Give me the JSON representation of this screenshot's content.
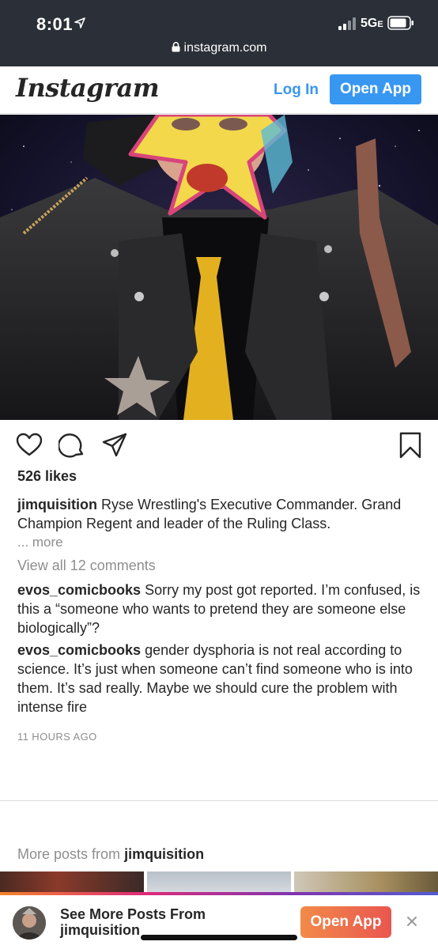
{
  "status_bar": {
    "time": "8:01",
    "network": "5G",
    "network_suffix": "E",
    "url": "instagram.com",
    "icons": [
      "location-arrow-icon",
      "signal-icon",
      "battery-icon",
      "lock-icon"
    ]
  },
  "header": {
    "logo": "Instagram",
    "login_label": "Log In",
    "open_app_label": "Open App"
  },
  "colors": {
    "brand_blue": "#3897f0",
    "status_bar_bg": "#2b3038",
    "muted_text": "#8e8e8e",
    "banner_button": "#ee6b4d"
  },
  "post": {
    "likes": "526 likes",
    "caption_user": "jimquisition",
    "caption_text": "Ryse Wrestling's Executive Commander. Grand Champion Regent and leader of the Ruling Class.",
    "more_label": "... more",
    "view_all_comments": "View all 12 comments",
    "comments": [
      {
        "user": "evos_comicbooks",
        "text": "Sorry my post got reported. I’m confused, is this a “someone who wants to pretend they are someone else biologically”?"
      },
      {
        "user": "evos_comicbooks",
        "text": "gender dysphoria is not real according to science. It’s just when someone can’t find someone who is into them. It’s sad really. Maybe we should cure the problem with intense fire"
      }
    ],
    "time_ago": "11 HOURS AGO"
  },
  "more_posts": {
    "prefix": "More posts from",
    "user": "jimquisition"
  },
  "banner": {
    "line1": "See More Posts From",
    "line2": "jimquisition",
    "open_app_label": "Open App"
  }
}
